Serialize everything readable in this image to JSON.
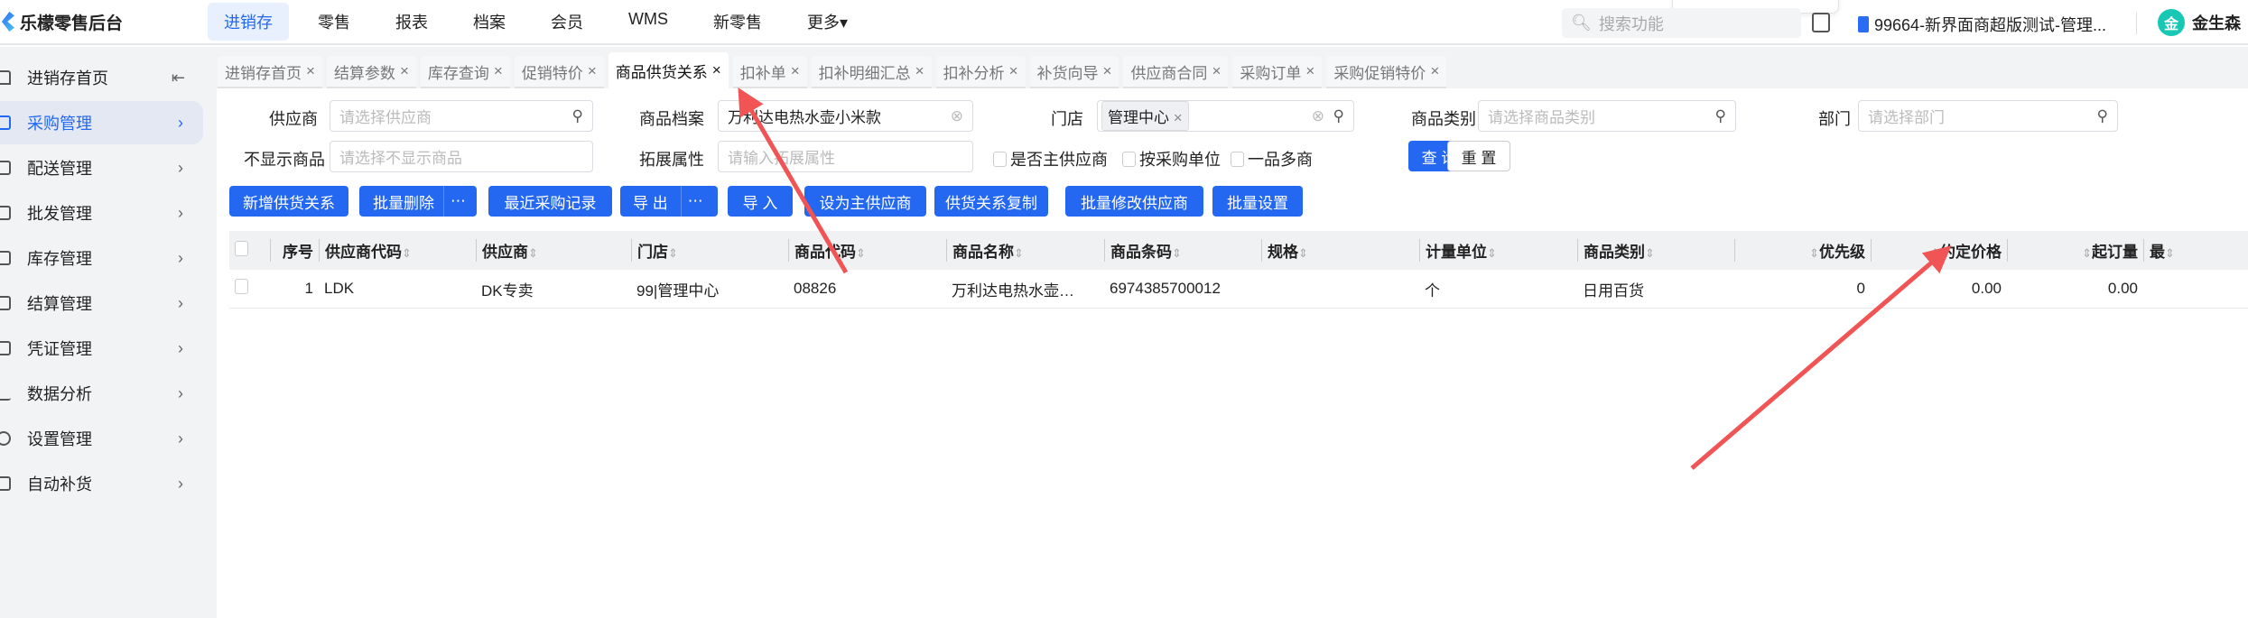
{
  "app": {
    "title": "乐檬零售后台"
  },
  "nav": [
    "进销存",
    "零售",
    "报表",
    "档案",
    "会员",
    "WMS",
    "新零售",
    "更多▾"
  ],
  "search_placeholder": "搜索功能",
  "org": "99664-新界面商超版测试-管理...",
  "user": {
    "avatar": "金",
    "name": "金生森"
  },
  "sidebar": {
    "home": "进销存首页",
    "collapse": "⇤",
    "items": [
      "采购管理",
      "配送管理",
      "批发管理",
      "库存管理",
      "结算管理",
      "凭证管理",
      "数据分析",
      "设置管理",
      "自动补货"
    ]
  },
  "tabs": [
    "进销存首页",
    "结算参数",
    "库存查询",
    "促销特价",
    "商品供货关系",
    "扣补单",
    "扣补明细汇总",
    "扣补分析",
    "补货向导",
    "供应商合同",
    "采购订单",
    "采购促销特价"
  ],
  "filters": {
    "supplier": {
      "label": "供应商",
      "placeholder": "请选择供应商"
    },
    "product": {
      "label": "商品档案",
      "value": "万利达电热水壶小米款"
    },
    "store": {
      "label": "门店",
      "tag": "管理中心"
    },
    "category": {
      "label": "商品类别",
      "placeholder": "请选择商品类别"
    },
    "dept": {
      "label": "部门",
      "placeholder": "请选择部门"
    },
    "hide": {
      "label": "不显示商品",
      "placeholder": "请选择不显示商品"
    },
    "ext": {
      "label": "拓展属性",
      "placeholder": "请输入拓展属性"
    },
    "checks": [
      "是否主供应商",
      "按采购单位",
      "一品多商"
    ],
    "query": "查 询",
    "reset": "重 置"
  },
  "actions": [
    "新增供货关系",
    "批量删除",
    "最近采购记录",
    "导 出",
    "导 入",
    "设为主供应商",
    "供货关系复制",
    "批量修改供应商",
    "批量设置"
  ],
  "table": {
    "headers": [
      "序号",
      "供应商代码",
      "供应商",
      "门店",
      "商品代码",
      "商品名称",
      "商品条码",
      "规格",
      "计量单位",
      "商品类别",
      "优先级",
      "约定价格",
      "起订量",
      "最"
    ],
    "rows": [
      [
        "1",
        "LDK",
        "DK专卖",
        "99|管理中心",
        "08826",
        "万利达电热水壶…",
        "6974385700012",
        "",
        "个",
        "日用百货",
        "0",
        "0.00",
        "0.00",
        ""
      ]
    ]
  },
  "colors": {
    "accent": "#2468f2",
    "annotation": "#f05454"
  }
}
